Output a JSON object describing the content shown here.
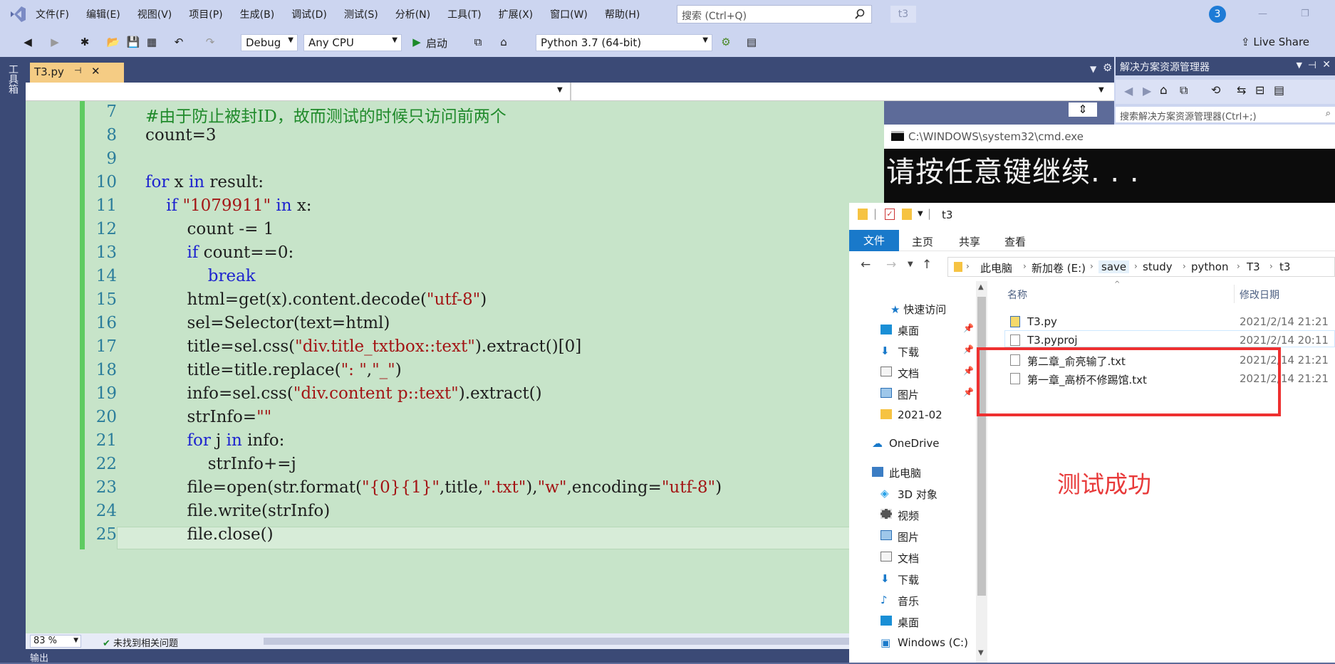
{
  "menubar": {
    "items": [
      "文件(F)",
      "编辑(E)",
      "视图(V)",
      "项目(P)",
      "生成(B)",
      "调试(D)",
      "测试(S)",
      "分析(N)",
      "工具(T)",
      "扩展(X)",
      "窗口(W)",
      "帮助(H)"
    ],
    "search_placeholder": "搜索 (Ctrl+Q)",
    "solution_name": "t3",
    "notification_count": "3"
  },
  "toolbar": {
    "config": "Debug",
    "platform": "Any CPU",
    "start_label": "启动",
    "environment": "Python 3.7 (64-bit)",
    "liveshare": "Live Share"
  },
  "left_strip": {
    "label": "工具箱"
  },
  "doc_tab": {
    "name": "T3.py"
  },
  "code": {
    "line_numbers": [
      "7",
      "8",
      "9",
      "10",
      "11",
      "12",
      "13",
      "14",
      "15",
      "16",
      "17",
      "18",
      "19",
      "20",
      "21",
      "22",
      "23",
      "24",
      "25"
    ]
  },
  "editor_status": {
    "zoom": "83 %",
    "issues": "未找到相关问题"
  },
  "output_strip": {
    "label": "输出"
  },
  "solution_explorer": {
    "title": "解决方案资源管理器",
    "search_placeholder": "搜索解决方案资源管理器(Ctrl+;)"
  },
  "cmd": {
    "title": "C:\\WINDOWS\\system32\\cmd.exe",
    "text": "请按任意键继续. . ."
  },
  "explorer": {
    "title": "t3",
    "ribbon": {
      "file": "文件",
      "home": "主页",
      "share": "共享",
      "view": "查看"
    },
    "breadcrumb": [
      "此电脑",
      "新加卷 (E:)",
      "save",
      "study",
      "python",
      "T3",
      "t3"
    ],
    "nav": {
      "quick_access": "快速访问",
      "desktop": "桌面",
      "downloads": "下载",
      "documents": "文档",
      "pictures": "图片",
      "folder": "2021-02",
      "onedrive": "OneDrive",
      "this_pc": "此电脑",
      "objects3d": "3D 对象",
      "videos": "视频",
      "pictures2": "图片",
      "documents2": "文档",
      "downloads2": "下载",
      "music": "音乐",
      "desktop2": "桌面",
      "drive_c": "Windows (C:)"
    },
    "columns": {
      "name": "名称",
      "date": "修改日期"
    },
    "files": [
      {
        "name": "T3.py",
        "date": "2021/2/14 21:21"
      },
      {
        "name": "T3.pyproj",
        "date": "2021/2/14 20:11"
      },
      {
        "name": "第二章_俞亮输了.txt",
        "date": "2021/2/14 21:21"
      },
      {
        "name": "第一章_高桥不修踢馆.txt",
        "date": "2021/2/14 21:21"
      }
    ]
  },
  "annotation": {
    "text": "测试成功"
  },
  "colors": {
    "accent": "#1979ca",
    "highlight": "#ee3030",
    "editor_bg": "#c7e4c9"
  }
}
